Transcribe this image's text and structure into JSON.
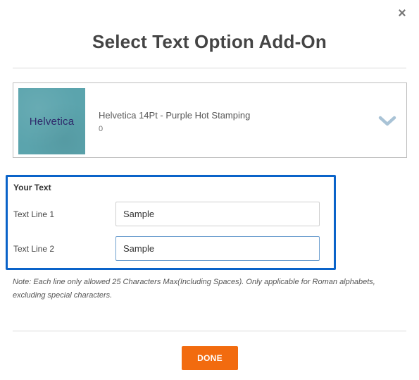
{
  "dialog": {
    "title": "Select Text Option Add-On",
    "close_icon": "close-icon"
  },
  "product": {
    "swatch_text": "Helvetica",
    "swatch_color": "#5ba4ad",
    "swatch_text_color": "#2f2a6b",
    "name": "Helvetica 14Pt - Purple Hot Stamping",
    "price": "0",
    "expand_icon": "chevron-down-icon"
  },
  "text_panel": {
    "heading": "Your Text",
    "lines": [
      {
        "label": "Text Line 1",
        "value": "Sample"
      },
      {
        "label": "Text Line 2",
        "value": "Sample"
      }
    ],
    "highlight_color": "#0a63c9"
  },
  "note": "Note: Each line only allowed 25 Characters Max(Including Spaces). Only applicable for Roman alphabets, excluding special characters.",
  "done_button": {
    "label": "DONE",
    "color": "#f26b0f"
  }
}
